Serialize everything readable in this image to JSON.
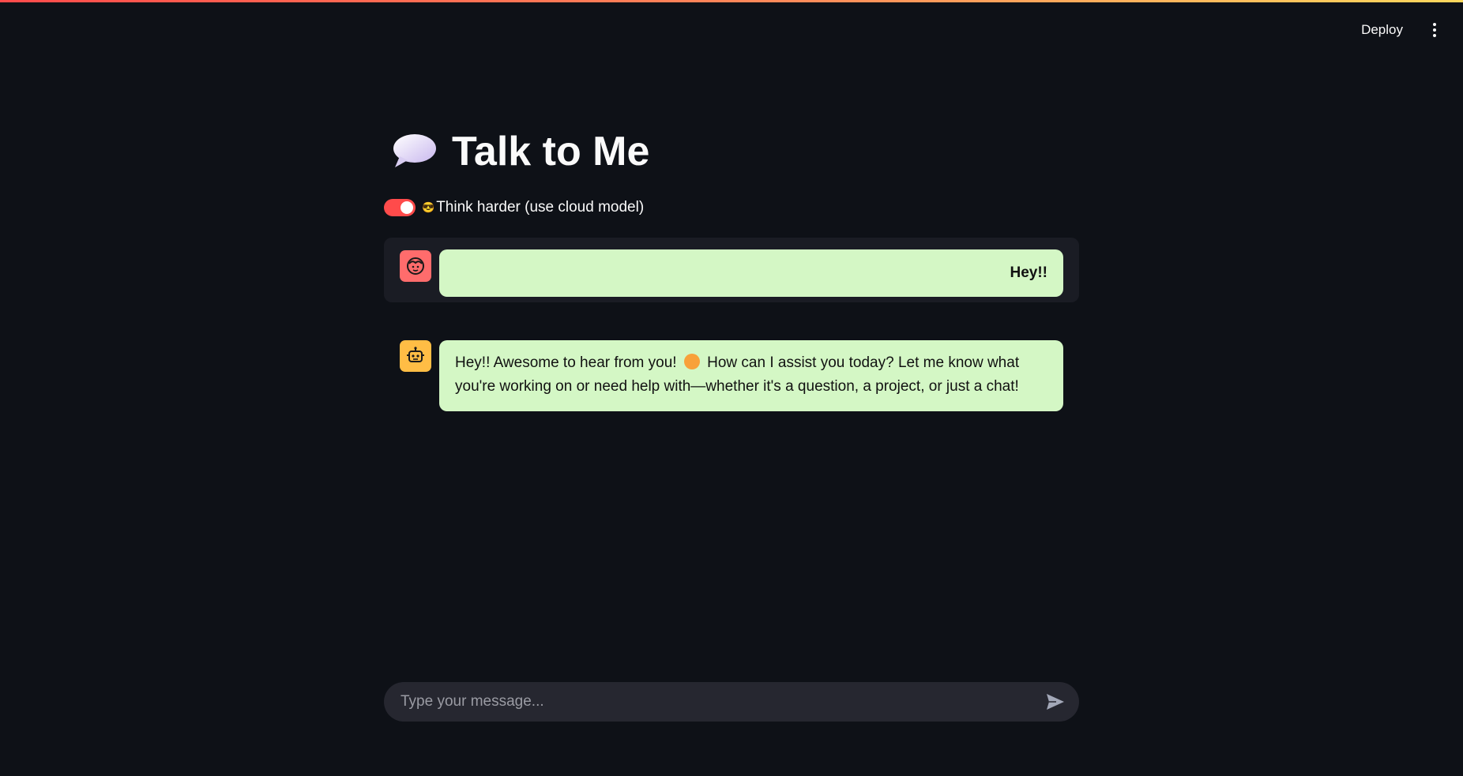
{
  "header": {
    "deploy_label": "Deploy"
  },
  "page": {
    "title": "Talk to Me",
    "title_icon": "speech-bubble-icon"
  },
  "toggle": {
    "emoji": "😎",
    "label": "Think harder (use cloud model)",
    "checked": true
  },
  "messages": [
    {
      "role": "user",
      "avatar_icon": "user-face-icon",
      "text": "Hey!!"
    },
    {
      "role": "assistant",
      "avatar_icon": "robot-icon",
      "text_part1": "Hey!! Awesome to hear from you!",
      "text_part2": "How can I assist you today? Let me know what you're working on or need help with—whether it's a question, a project, or just a chat!"
    }
  ],
  "chat_input": {
    "placeholder": "Type your message..."
  },
  "colors": {
    "background": "#0e1117",
    "accent": "#ff4b4b",
    "bubble": "#d4f7c5",
    "user_avatar": "#ff6c6c",
    "bot_avatar": "#ffbd45"
  }
}
